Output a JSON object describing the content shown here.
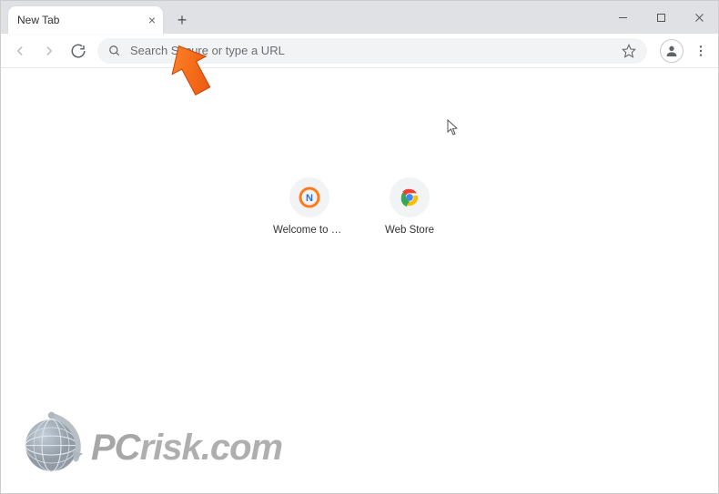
{
  "tab": {
    "title": "New Tab"
  },
  "omnibox": {
    "placeholder": "Search Secure or type a URL"
  },
  "shortcuts": [
    {
      "label": "Welcome to R...",
      "icon": "n-orange"
    },
    {
      "label": "Web Store",
      "icon": "chrome"
    }
  ],
  "watermark": {
    "text_pc": "PC",
    "text_rest": "risk.com"
  },
  "annotation": {
    "arrow_color": "#ff6a13"
  }
}
